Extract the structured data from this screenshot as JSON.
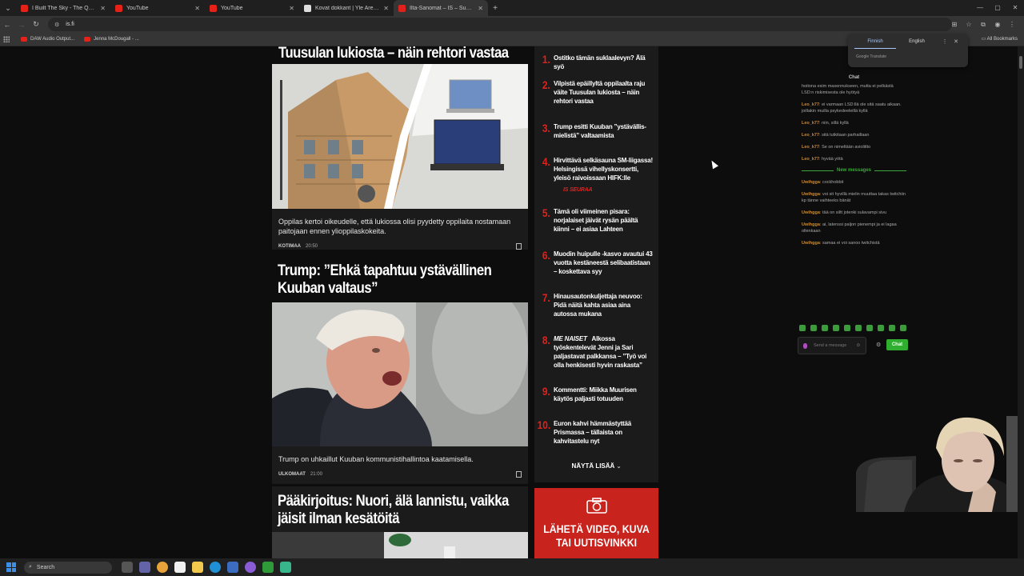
{
  "browser": {
    "tabs": [
      {
        "title": "I Built The Sky - The Quiet Place",
        "active": false,
        "favicon_color": "#e62117"
      },
      {
        "title": "YouTube",
        "active": false,
        "favicon_color": "#e62117"
      },
      {
        "title": "YouTube",
        "active": false,
        "favicon_color": "#e62117"
      },
      {
        "title": "Kovat dokkarit | Yle Areena",
        "active": false,
        "favicon_color": "#dddddd"
      },
      {
        "title": "Ilta-Sanomat – IS – Suomen suurin",
        "active": true,
        "favicon_color": "#e0221d"
      }
    ],
    "url": "is.fi",
    "bookmarks": [
      "DAW Audio Output...",
      "Jenna McDougall - ..."
    ],
    "all_bookmarks": "All Bookmarks"
  },
  "translate": {
    "from_lang": "Finnish",
    "to_lang": "English",
    "brand": "Google Translate"
  },
  "articles": [
    {
      "headline": "Tuusulan lukiosta – näin rehtori vastaa",
      "caption": "Oppilas kertoi oikeudelle, että lukiossa olisi pyydetty oppilaita nostamaan paitojaan ennen ylioppilaskokeita.",
      "section": "KOTIMAA",
      "time": "20:50"
    },
    {
      "headline": "Trump: ”Ehkä tapahtuu ystävällinen Kuuban valtaus”",
      "headline_line1": "Trump: ”Ehkä tapahtuu ystävällinen",
      "headline_line2": "Kuuban valtaus”",
      "caption": "Trump on uhkaillut Kuuban kommunistihallintoa kaatamisella.",
      "section": "ULKOMAAT",
      "time": "21:00"
    },
    {
      "headline_line1": "Pääkirjoitus: Nuori, älä lannistu, vaikka",
      "headline_line2": "jäisit ilman kesätöitä"
    }
  ],
  "most_read": [
    {
      "rank": "1.",
      "title": "Ostitko tämän suklaalevyn? Älä syö"
    },
    {
      "rank": "2.",
      "title": "Vilpistä epäillyltä oppilaalta raju väite Tuusulan lukiosta – näin rehtori vastaa"
    },
    {
      "rank": "3.",
      "title": "Trump esitti Kuuban ”ystävällis-mielistä” valtaamista"
    },
    {
      "rank": "4.",
      "title": "Hirvittävä selkäsauna SM-liigassa! Helsingissä vihellyskonsertti, yleisö raivoissaan HIFK:lle",
      "tag": "IS SEURAA"
    },
    {
      "rank": "5.",
      "title": "Tämä oli viimeinen pisara: norjalaiset jäivät rysän päältä kiinni – ei asiaa Lahteen"
    },
    {
      "rank": "6.",
      "title": "Muodin huipulle -kasvo avautui 43 vuotta kestäneestä selibaatistaan – koskettava syy"
    },
    {
      "rank": "7.",
      "title": "Hinausautonkuljettaja neuvoo: Pidä näitä kahta asiaa aina autossa mukana"
    },
    {
      "rank": "8.",
      "brand": "ME NAISET",
      "title": "Alkossa työskentelevät Jenni ja Sari paljastavat palkkansa – ”Työ voi olla henkisesti hyvin raskasta”"
    },
    {
      "rank": "9.",
      "title": "Kommentti: Miikka Muurisen käytös paljasti totuuden"
    },
    {
      "rank": "10.",
      "title": "Euron kahvi hämmästyttää Prismassa – tällaista on kahvitastelu nyt"
    }
  ],
  "show_more": "NÄYTÄ LISÄÄ",
  "promo": {
    "line1": "LÄHETÄ VIDEO, KUVA",
    "line2": "TAI UUTISVINKKI"
  },
  "chat": {
    "title": "Chat",
    "messages": [
      {
        "user": "",
        "text": "hoitona esim masennukseen, mutta ei pelkästä LSD:n riskimisesta ole hyötyä",
        "color": "#a9a9a9"
      },
      {
        "user": "Leo_k77",
        "text": ": ei varmaan LSD:llä ole sitä saatu aikaan. joillakin muilla psykedeeleillä kyllä",
        "color": "#c9873a"
      },
      {
        "user": "Leo_k77",
        "text": ": niin, sillä kyllä",
        "color": "#c9873a"
      },
      {
        "user": "Leo_k77",
        "text": ": sitä tutkitaan parhaillaan",
        "color": "#c9873a"
      },
      {
        "user": "Leo_k77",
        "text": ": Se on nimeltään avioliitto",
        "color": "#c9873a"
      },
      {
        "user": "Leo_k77",
        "text": ": hyvää yötä",
        "color": "#c9873a"
      }
    ],
    "new_messages_label": "New messages",
    "new_messages": [
      {
        "user": "Uwihgga",
        "text": ": cockhobbit",
        "color": "#d08a2a"
      },
      {
        "user": "Uwihgga",
        "text": ": voi sit hyvillä mielin muuttaa takas twitchiin kp tänne vaihteeks bänät",
        "color": "#d08a2a"
      },
      {
        "user": "Uwihgga",
        "text": ": tää on siltt jotenki sulavampi sivu",
        "color": "#d08a2a"
      },
      {
        "user": "Uwihgga",
        "text": ": ai, latenssi paljon pienempi ja ei lagaa ollenkaan",
        "color": "#d08a2a"
      },
      {
        "user": "Uwihgga",
        "text": ": samaa ei voi sanoo twitchistä",
        "color": "#d08a2a"
      }
    ],
    "input_placeholder": "Send a message",
    "send_label": "Chat"
  },
  "taskbar": {
    "search_label": "Search"
  }
}
